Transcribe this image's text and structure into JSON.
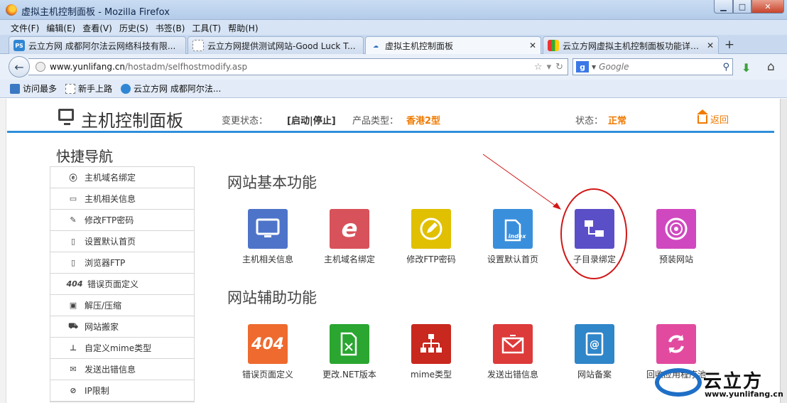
{
  "window": {
    "title": "虚拟主机控制面板 - Mozilla Firefox"
  },
  "menu": [
    "文件(F)",
    "编辑(E)",
    "查看(V)",
    "历史(S)",
    "书签(B)",
    "工具(T)",
    "帮助(H)"
  ],
  "tabs": [
    {
      "label": "云立方网 成都阿尔法云网络科技有限...",
      "icon": "ps-favicon-icon"
    },
    {
      "label": "云立方网提供测试网站-Good Luck T...",
      "icon": "blank-page-icon"
    },
    {
      "label": "虚拟主机控制面板",
      "icon": "cloud-favicon-icon",
      "active": true
    },
    {
      "label": "云立方网虚拟主机控制面板功能详解...",
      "icon": "multicolor-favicon-icon"
    }
  ],
  "address": {
    "host": "www.yunlifang.cn",
    "path": "/hostadm/selfhostmodify.asp"
  },
  "search": {
    "placeholder": "Google"
  },
  "bookmarks": [
    "访问最多",
    "新手上路",
    "云立方网 成都阿尔法..."
  ],
  "header": {
    "title": "主机控制面板",
    "change_label": "变更状态：",
    "change_value": "[启动|停止]",
    "product_label": "产品类型：",
    "product_value": "香港2型",
    "status_label": "状态：",
    "status_value": "正常",
    "back_label": "返回"
  },
  "sidebar": {
    "title": "快捷导航",
    "items": [
      {
        "label": "主机域名绑定",
        "icon": "ie-logo-icon"
      },
      {
        "label": "主机相关信息",
        "icon": "monitor-icon"
      },
      {
        "label": "修改FTP密码",
        "icon": "pencil-circle-icon"
      },
      {
        "label": "设置默认首页",
        "icon": "document-icon"
      },
      {
        "label": "浏览器FTP",
        "icon": "document-icon"
      },
      {
        "label": "错误页面定义",
        "icon": "404-icon",
        "prefix": "404"
      },
      {
        "label": "解压/压缩",
        "icon": "archive-icon"
      },
      {
        "label": "网站搬家",
        "icon": "truck-icon"
      },
      {
        "label": "自定义mime类型",
        "icon": "sitemap-icon"
      },
      {
        "label": "发送出错信息",
        "icon": "envelope-icon"
      },
      {
        "label": "IP限制",
        "icon": "no-sign-icon"
      }
    ]
  },
  "basic": {
    "title": "网站基本功能",
    "tiles": [
      {
        "label": "主机相关信息",
        "color": "#4e74c9",
        "icon": "monitor-icon"
      },
      {
        "label": "主机域名绑定",
        "color": "#d7525a",
        "icon": "ie-logo-icon"
      },
      {
        "label": "修改FTP密码",
        "color": "#e0c000",
        "icon": "pencil-circle-icon"
      },
      {
        "label": "设置默认首页",
        "color": "#3a8fdc",
        "icon": "index-document-icon",
        "icon_text": "index"
      },
      {
        "label": "子目录绑定",
        "color": "#5b4fc7",
        "icon": "folder-tree-icon"
      },
      {
        "label": "预装网站",
        "color": "#d048c0",
        "icon": "disc-icon"
      }
    ]
  },
  "extra": {
    "title": "网站辅助功能",
    "tiles": [
      {
        "label": "错误页面定义",
        "color": "#ee6a2e",
        "icon": "404-icon",
        "icon_text": "404"
      },
      {
        "label": "更改.NET版本",
        "color": "#2aa631",
        "icon": "file-shuffle-icon"
      },
      {
        "label": "mime类型",
        "color": "#c8281e",
        "icon": "sitemap-icon"
      },
      {
        "label": "发送出错信息",
        "color": "#dd3a3a",
        "icon": "envelope-icon"
      },
      {
        "label": "网站备案",
        "color": "#2f86c9",
        "icon": "address-book-icon"
      },
      {
        "label": "回收应用程序池",
        "color": "#e24aa0",
        "icon": "refresh-icon"
      }
    ]
  },
  "watermark": {
    "name": "云立方",
    "url": "www.yunlifang.cn"
  }
}
